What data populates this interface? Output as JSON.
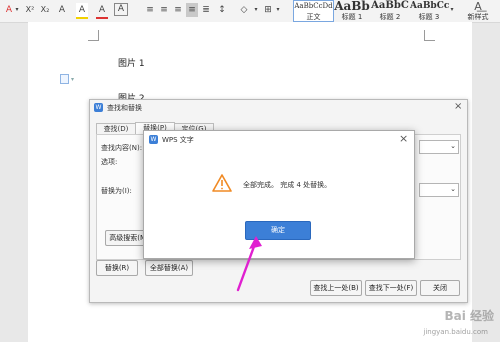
{
  "ribbon": {
    "font_color_glyph": "A",
    "superscript_glyph": "X²",
    "subscript_glyph": "X₂",
    "clear_format_glyph": "A",
    "highlight_glyph": "A",
    "font_color2_glyph": "A",
    "char_border_glyph": "A",
    "styles": [
      {
        "preview": "AaBbCcDd",
        "label": "正文"
      },
      {
        "preview": "AaBb",
        "label": "标题 1"
      },
      {
        "preview": "AaBbC",
        "label": "标题 2"
      },
      {
        "preview": "AaBbCc",
        "label": "标题 3"
      }
    ],
    "new_style_label": "新样式"
  },
  "document": {
    "line1": "图片 1",
    "line2": "图片 2"
  },
  "find_replace": {
    "title": "查找和替换",
    "tabs": [
      "查找(D)",
      "替换(P)",
      "定位(G)"
    ],
    "find_label": "查找内容(N):",
    "options_label": "选项:",
    "replace_label": "替换为(I):",
    "advanced_button": "高级搜索(M)",
    "replace_button": "替换(R)",
    "replace_all_button": "全部替换(A)",
    "find_prev_button": "查找上一处(B)",
    "find_next_button": "查找下一处(F)",
    "close_button": "关闭"
  },
  "message_box": {
    "title": "WPS 文字",
    "message": "全部完成。 完成 4 处替换。",
    "ok_button": "确定"
  },
  "watermark": {
    "brand": "Bai 经验",
    "url": "jingyan.baidu.com"
  },
  "colors": {
    "accent": "#3c7fd7",
    "arrow": "#e020d0",
    "warning": "#f08a24"
  }
}
